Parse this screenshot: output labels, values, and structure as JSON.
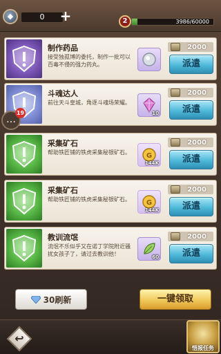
{
  "header": {
    "currency_value": "0",
    "plus_label": "+",
    "level": "2",
    "exp_text": "3986/60000",
    "exp_fraction": 0.0664
  },
  "side_chat": {
    "badge_count": "19",
    "icon": "chat-bubble-icon"
  },
  "tasks": [
    {
      "title": "制作药品",
      "desc": "接受独孤博的委托，制作一批可以百毒不侵的强力药丸。",
      "emblem": "purple",
      "item": "pill-icon",
      "item_count": "",
      "reward": "2000",
      "button": "派遣"
    },
    {
      "title": "斗魂达人",
      "desc": "前往天斗皇城，角逐斗魂场荣耀。",
      "emblem": "blue",
      "item": "crystal-icon",
      "item_count": "10",
      "reward": "2000",
      "button": "派遣"
    },
    {
      "title": "采集矿石",
      "desc": "帮助铁匠铺的铁虎采集秘银矿石。",
      "emblem": "green",
      "item": "gold-coin-icon",
      "item_count": "144K",
      "reward": "2000",
      "button": "派遣"
    },
    {
      "title": "采集矿石",
      "desc": "帮助铁匠铺的铁虎采集秘银矿石。",
      "emblem": "green",
      "item": "gold-coin-icon",
      "item_count": "144K",
      "reward": "2000",
      "button": "派遣"
    },
    {
      "title": "教训流氓",
      "desc": "流氓不乐似乎又在诺丁学院附近骚扰女孩子了，请过去教训他！",
      "emblem": "green",
      "item": "leaf-badge-icon",
      "item_count": "60",
      "reward": "2000",
      "button": "派遣"
    }
  ],
  "footer": {
    "refresh_label": "30刷新",
    "claim_all_label": "一键领取",
    "mission_label": "悟报任务"
  }
}
